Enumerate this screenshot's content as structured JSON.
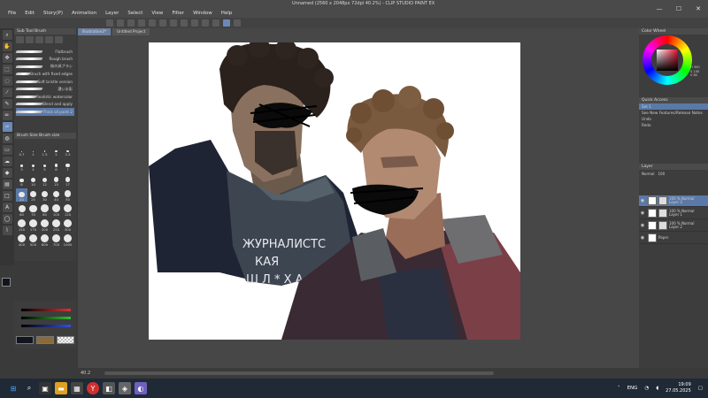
{
  "window": {
    "title": "Unnamed (2560 x 2048px 72dpi 40.2%) - CLIP STUDIO PAINT EX",
    "controls": [
      "—",
      "☐",
      "✕"
    ]
  },
  "menu": [
    "File",
    "Edit",
    "Story(P)",
    "Animation",
    "Layer",
    "Select",
    "View",
    "Filter",
    "Window",
    "Help"
  ],
  "subtool": {
    "header": "Sub Tool  Brush",
    "brushes": [
      {
        "label": "Flatbrush"
      },
      {
        "label": "Rough brush"
      },
      {
        "label": "絵の具ブラシ"
      },
      {
        "label": "Brush with fixed edges"
      },
      {
        "label": "Soft bristle version"
      },
      {
        "label": "濃い水彩"
      },
      {
        "label": "Realistic watercolor"
      },
      {
        "label": "Blend and apply"
      },
      {
        "label": "Thick oil paint 2"
      }
    ]
  },
  "brushsize": {
    "header": "Brush Size  Brush size",
    "sizes": [
      "0.7",
      "1",
      "1.5",
      "2",
      "2.5",
      "3",
      "4",
      "5",
      "6",
      "7",
      "8",
      "10",
      "12",
      "15",
      "17",
      "20",
      "25",
      "30",
      "40",
      "50",
      "60",
      "70",
      "80",
      "100",
      "120",
      "150",
      "170",
      "200",
      "250",
      "300",
      "400",
      "500",
      "600",
      "700",
      "1000"
    ],
    "selected_index": 15
  },
  "color_wheel": {
    "header": "Color Wheel",
    "values": [
      "H 350",
      "S 100",
      "V 82"
    ]
  },
  "quick_access": {
    "header": "Quick Access",
    "set": "Set 1",
    "items": [
      "See New Features/Release Notes",
      "Undo",
      "Redo"
    ]
  },
  "layers": {
    "header": "Layer",
    "blend_mode": "Normal",
    "opacity": "100",
    "rows": [
      {
        "line1": "100 % Normal",
        "line2": "Layer 3",
        "selected": true
      },
      {
        "line1": "100 % Normal",
        "line2": "Layer 1",
        "selected": false
      },
      {
        "line1": "100 % Normal",
        "line2": "Layer 2",
        "selected": false
      },
      {
        "line1": "",
        "line2": "Paper",
        "selected": false
      }
    ]
  },
  "canvas": {
    "tabs": [
      "Illustration2*",
      "Untitled Project"
    ],
    "shirt_text": [
      "ЖУРНАЛИСТС",
      "КАЯ",
      "Ш Л * Х А"
    ]
  },
  "statusbar": {
    "zoom": "40.2"
  },
  "taskbar": {
    "lang": "ENG",
    "time": "19:09",
    "date": "27.05.2025"
  },
  "colors": {
    "main": "#12151f",
    "sub": "#8a6a3a",
    "accent": "#5a79a8"
  }
}
